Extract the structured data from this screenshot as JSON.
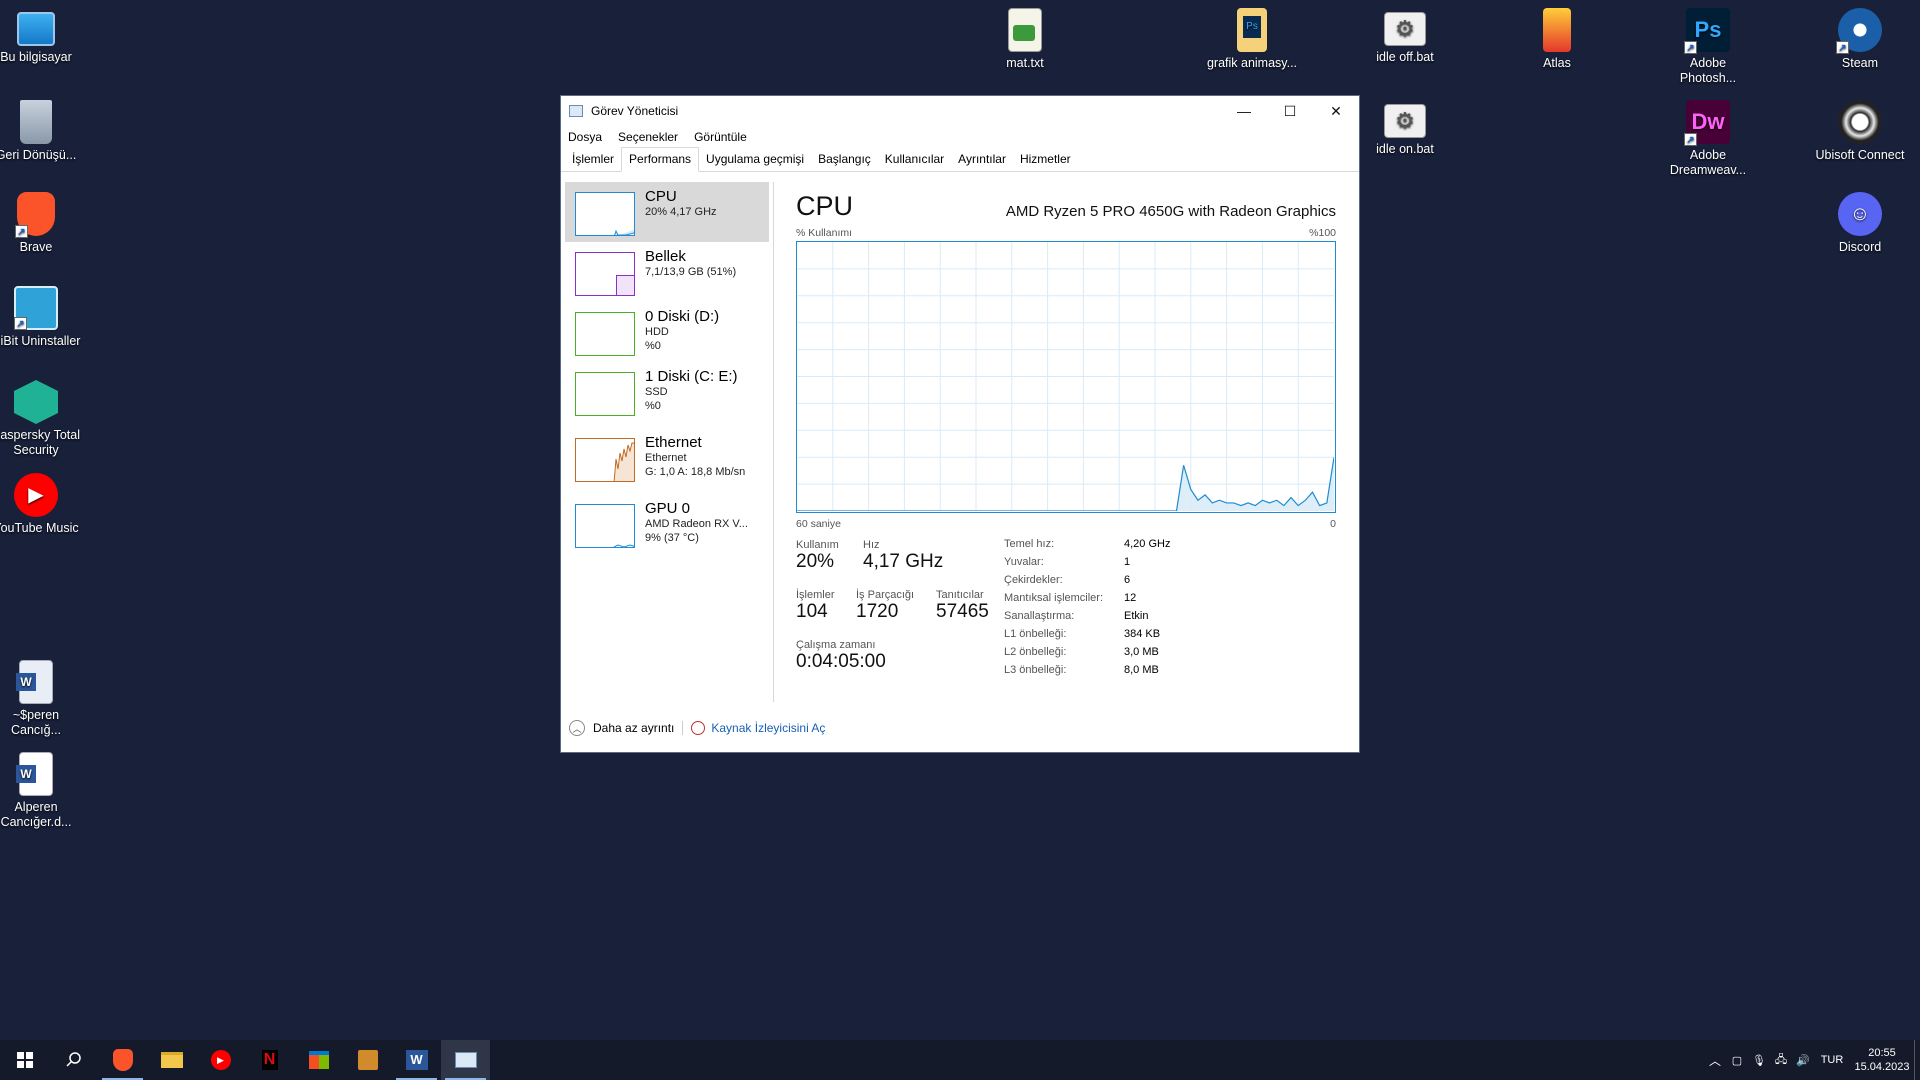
{
  "desktop": {
    "icons": [
      {
        "label": "Bu bilgisayar"
      },
      {
        "label": "Geri Dönüşü..."
      },
      {
        "label": "Brave"
      },
      {
        "label": "HiBit Uninstaller"
      },
      {
        "label": "Kaspersky Total Security"
      },
      {
        "label": "YouTube Music"
      },
      {
        "label": "~$peren Cancığ..."
      },
      {
        "label": "Alperen Cancığer.d..."
      },
      {
        "label": "mat.txt"
      },
      {
        "label": "grafik animasy..."
      },
      {
        "label": "idle off.bat"
      },
      {
        "label": "idle on.bat"
      },
      {
        "label": "Atlas"
      },
      {
        "label": "Adobe Photosh..."
      },
      {
        "label": "Adobe Dreamweav..."
      },
      {
        "label": "Steam"
      },
      {
        "label": "Ubisoft Connect"
      },
      {
        "label": "Discord"
      }
    ]
  },
  "window": {
    "title": "Görev Yöneticisi",
    "menu": [
      "Dosya",
      "Seçenekler",
      "Görüntüle"
    ],
    "tabs": [
      "İşlemler",
      "Performans",
      "Uygulama geçmişi",
      "Başlangıç",
      "Kullanıcılar",
      "Ayrıntılar",
      "Hizmetler"
    ],
    "active_tab": "Performans"
  },
  "sidebar": [
    {
      "name": "CPU",
      "line1": "20% 4,17 GHz",
      "line2": "",
      "color": "#1f8bd1"
    },
    {
      "name": "Bellek",
      "line1": "7,1/13,9 GB (51%)",
      "line2": "",
      "color": "#8b2fc9"
    },
    {
      "name": "0 Diski (D:)",
      "line1": "HDD",
      "line2": "%0",
      "color": "#4caf28"
    },
    {
      "name": "1 Diski (C: E:)",
      "line1": "SSD",
      "line2": "%0",
      "color": "#4caf28"
    },
    {
      "name": "Ethernet",
      "line1": "Ethernet",
      "line2": "G: 1,0  A: 18,8 Mb/sn",
      "color": "#c06b25"
    },
    {
      "name": "GPU 0",
      "line1": "AMD Radeon RX V...",
      "line2": "9% (37 °C)",
      "color": "#1f8bd1"
    }
  ],
  "cpu": {
    "title": "CPU",
    "model": "AMD Ryzen 5 PRO 4650G with Radeon Graphics",
    "usage_label": "% Kullanımı",
    "max_label": "%100",
    "time_label": "60 saniye",
    "zero_label": "0",
    "stats": {
      "kullanim_label": "Kullanım",
      "kullanim": "20%",
      "hiz_label": "Hız",
      "hiz": "4,17 GHz",
      "islemler_label": "İşlemler",
      "islemler": "104",
      "is_parcacigi_label": "İş Parçacığı",
      "is_parcacigi": "1720",
      "taniticilar_label": "Tanıtıcılar",
      "taniticilar": "57465",
      "calisma_label": "Çalışma zamanı",
      "calisma": "0:04:05:00"
    },
    "props": [
      {
        "k": "Temel hız:",
        "v": "4,20 GHz"
      },
      {
        "k": "Yuvalar:",
        "v": "1"
      },
      {
        "k": "Çekirdekler:",
        "v": "6"
      },
      {
        "k": "Mantıksal işlemciler:",
        "v": "12"
      },
      {
        "k": "Sanallaştırma:",
        "v": "Etkin"
      },
      {
        "k": "L1 önbelleği:",
        "v": "384 KB"
      },
      {
        "k": "L2 önbelleği:",
        "v": "3,0 MB"
      },
      {
        "k": "L3 önbelleği:",
        "v": "8,0 MB"
      }
    ],
    "graph_values": [
      0,
      0,
      0,
      0,
      0,
      0,
      0,
      0,
      0,
      0,
      0,
      0,
      0,
      0,
      0,
      0,
      0,
      0,
      0,
      0,
      0,
      0,
      0,
      0,
      0,
      0,
      0,
      0,
      0,
      0,
      0,
      0,
      0,
      0,
      0,
      0,
      0,
      0,
      0,
      0,
      0,
      0,
      0,
      0,
      0,
      0,
      0,
      0,
      0,
      0,
      0,
      0,
      0,
      0,
      17,
      8,
      4,
      6,
      3,
      4,
      3,
      3,
      2,
      3,
      2,
      4,
      3,
      4,
      2,
      5,
      2,
      4,
      7,
      2,
      3,
      20
    ]
  },
  "footer": {
    "less_details": "Daha az ayrıntı",
    "resource_monitor": "Kaynak İzleyicisini Aç"
  },
  "taskbar": {
    "lang": "TUR",
    "time": "20:55",
    "date": "15.04.2023"
  }
}
